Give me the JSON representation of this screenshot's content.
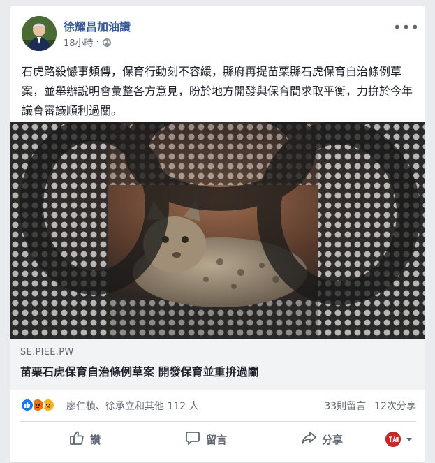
{
  "post": {
    "author": "徐耀昌加油讚",
    "time": "18小時",
    "separator": "·",
    "more_label": "•••",
    "text": "石虎路殺憾事頻傳，保育行動刻不容緩，縣府再提苗栗縣石虎保育自治條例草案，並舉辦說明會彙整各方意見，盼於地方開發與保育間求取平衡，力拚於今年議會審議順利過關。"
  },
  "link": {
    "domain": "SE.PIEE.PW",
    "title": "苗栗石虎保育自治條例草案 開發保育並重拚過關"
  },
  "stats": {
    "reaction_names": "廖仁楨、徐承立和其他 112 人",
    "comments": "33則留言",
    "shares": "12次分享"
  },
  "actions": {
    "like": "讚",
    "comment": "留言",
    "share": "分享"
  },
  "colors": {
    "author": "#385898",
    "like_blue": "#1877f2",
    "angry_orange": "#e9710f",
    "sad_yellow": "#f7b125"
  },
  "icons": [
    "globe-icon",
    "more-icon",
    "like-reaction-icon",
    "angry-reaction-icon",
    "sad-reaction-icon",
    "thumbs-up-icon",
    "comment-icon",
    "share-icon",
    "chevron-down-icon"
  ]
}
